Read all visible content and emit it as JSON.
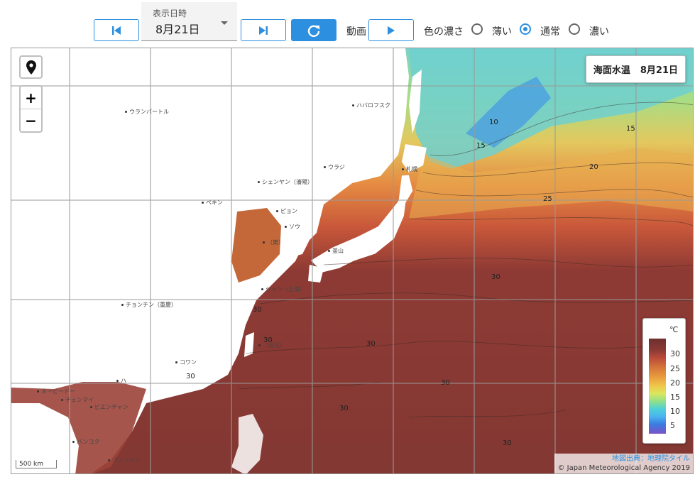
{
  "toolbar": {
    "date_caption": "表示日時",
    "date_value": "8月21日",
    "animation_label": "動画",
    "density_label": "色の濃さ",
    "density_options": [
      "薄い",
      "通常",
      "濃い"
    ],
    "density_selected": "通常"
  },
  "map": {
    "title_main": "海面水温",
    "title_date": "8月21日",
    "zoom_in": "+",
    "zoom_out": "−",
    "scale_label": "500 km",
    "attribution_source": "地図出典：地理院タイル",
    "attribution_copyright": "© Japan Meteorological Agency 2019",
    "legend": {
      "unit": "℃",
      "ticks": [
        "30",
        "25",
        "20",
        "15",
        "10",
        "5"
      ],
      "accent": "#2d8fdf"
    },
    "places": [
      "ウランバートル",
      "ハバロフスク",
      "ウラジ",
      "札幌",
      "シェンヤン（瀋陽）",
      "ペキン",
      "ピョン",
      "ソウ",
      "（東）",
      "釜山",
      "チョンチン（重慶）",
      "シャン（上海）",
      "コワン",
      "ネーピードー",
      "チェンマイ",
      "ビエンチャン",
      "バンコク",
      "プノンペン",
      "（台北）",
      "ハ"
    ],
    "contour_labels": [
      "10",
      "15",
      "15",
      "20",
      "25",
      "30",
      "30",
      "30",
      "30",
      "30",
      "30",
      "30",
      "30"
    ]
  }
}
